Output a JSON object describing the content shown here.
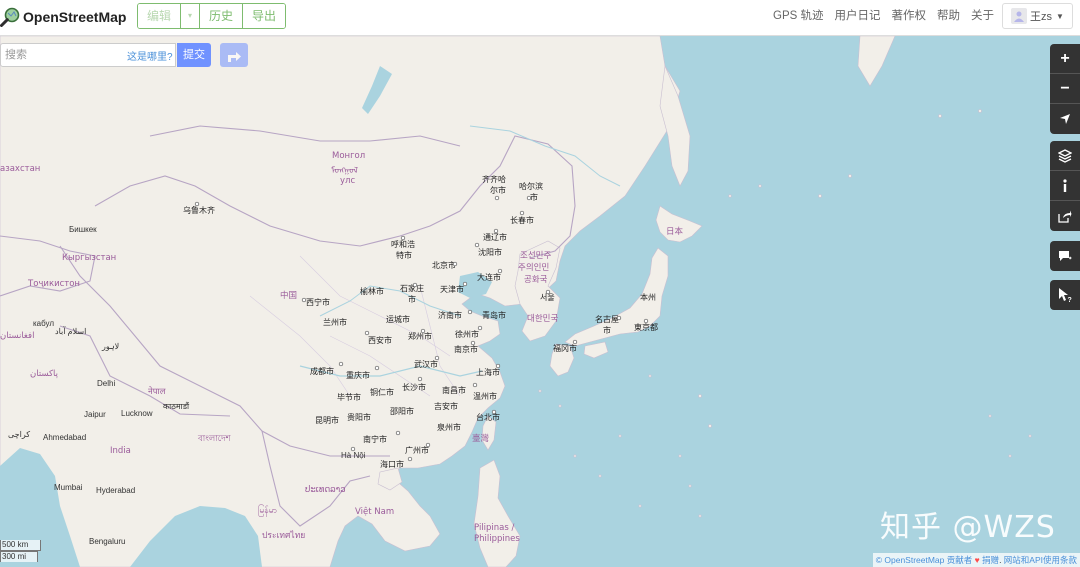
{
  "header": {
    "logo_text": "OpenStreetMap",
    "edit_label": "编辑",
    "history_label": "历史",
    "export_label": "导出",
    "nav": [
      "GPS 轨迹",
      "用户日记",
      "著作权",
      "帮助",
      "关于"
    ],
    "user_name": "王zs"
  },
  "search": {
    "placeholder": "搜索",
    "where_link": "这是哪里?",
    "submit_label": "提交"
  },
  "controls": {
    "zoom_in": "+",
    "zoom_out": "−"
  },
  "scale": {
    "km": "500 km",
    "mi": "300 mi"
  },
  "attribution": {
    "copyright": "© OpenStreetMap 贡献者",
    "donate": "捐赠",
    "terms": "网站和API使用条款"
  },
  "watermark": "知乎 @WZS",
  "map_labels": {
    "mongolia": "Монгол",
    "mongolia_script": "ᠮᠣᠩᠭᠣᠯ",
    "mongolia_uls": "улс",
    "china": "中国",
    "japan": "日本",
    "korea_north_1": "조선민주",
    "korea_north_2": "주의인민",
    "korea_north_3": "공화국",
    "korea_south": "대한민국",
    "india": "India",
    "kazakhstan": "азахстан",
    "kyrgyzstan": "Кыргызстан",
    "tajikistan": "Тоҷикистон",
    "afghanistan": "افغانستان",
    "pakistan": "پاکستان",
    "nepal": "नेपाल",
    "bangladesh": "বাংলাদেশ",
    "myanmar": "မြန်မာ",
    "laos": "ປະເທດລາວ",
    "thailand": "ประเทศไทย",
    "vietnam": "Việt Nam",
    "philippines_1": "Pilipinas /",
    "philippines_2": "Philippines",
    "taiwan": "臺灣",
    "cities": [
      "乌鲁木齐",
      "齐齐哈",
      "尔市",
      "哈尔滨",
      "市",
      "长春市",
      "通辽市",
      "呼和浩",
      "特市",
      "沈阳市",
      "北京市",
      "大连市",
      "서울",
      "榆林市",
      "石家庄",
      "市",
      "天津市",
      "西宁市",
      "兰州市",
      "运城市",
      "济南市",
      "青岛市",
      "徐州市",
      "西安市",
      "郑州市",
      "南京市",
      "成都市",
      "重庆市",
      "武汉市",
      "上海市",
      "长沙市",
      "南昌市",
      "毕节市",
      "铜仁市",
      "温州市",
      "昆明市",
      "贵阳市",
      "邵阳市",
      "吉安市",
      "台北市",
      "泉州市",
      "南宁市",
      "广州市",
      "Hà Nội",
      "海口市",
      "福冈市",
      "名古屋",
      "市",
      "東京都",
      "本州",
      "Бишкек",
      "кабул",
      "اسلام آباد",
      "لاہور",
      "Delhi",
      "Jaipur",
      "Lucknow",
      "Ahmedabad",
      "Mumbai",
      "Hyderabad",
      "Bengaluru",
      "काठमाडौं",
      "کراچی"
    ]
  }
}
